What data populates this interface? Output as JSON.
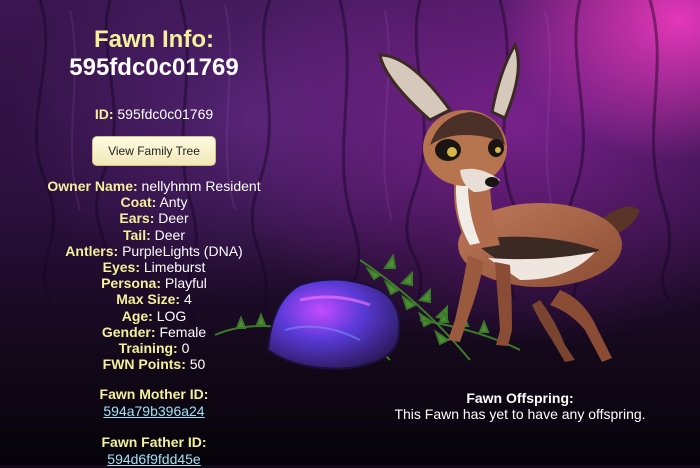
{
  "header": {
    "title_label": "Fawn Info:",
    "title_value": "595fdc0c01769"
  },
  "id_row": {
    "label": "ID:",
    "value": "595fdc0c01769"
  },
  "family_tree_button": "View Family Tree",
  "attributes": [
    {
      "label": "Owner Name:",
      "value": "nellyhmm Resident"
    },
    {
      "label": "Coat:",
      "value": "Anty"
    },
    {
      "label": "Ears:",
      "value": "Deer"
    },
    {
      "label": "Tail:",
      "value": "Deer"
    },
    {
      "label": "Antlers:",
      "value": "PurpleLights (DNA)"
    },
    {
      "label": "Eyes:",
      "value": "Limeburst"
    },
    {
      "label": "Persona:",
      "value": "Playful"
    },
    {
      "label": "Max Size:",
      "value": "4"
    },
    {
      "label": "Age:",
      "value": "LOG"
    },
    {
      "label": "Gender:",
      "value": "Female"
    },
    {
      "label": "Training:",
      "value": "0"
    },
    {
      "label": "FWN Points:",
      "value": "50"
    }
  ],
  "mother": {
    "label": "Fawn Mother ID:",
    "value": "594a79b396a24"
  },
  "father": {
    "label": "Fawn Father ID:",
    "value": "594d6f9fdd45e"
  },
  "offspring": {
    "title": "Fawn Offspring:",
    "text": "This Fawn has yet to have any offspring."
  },
  "colors": {
    "label_yellow": "#f5f09a",
    "link_cyan": "#9fe2f2",
    "button_bg": "#fffbe0",
    "accent_pink": "#ff3cc8"
  },
  "illustration": {
    "subject": "fawn-illustration",
    "scene": [
      "purple-rock",
      "fern-plant",
      "bark-background"
    ]
  }
}
